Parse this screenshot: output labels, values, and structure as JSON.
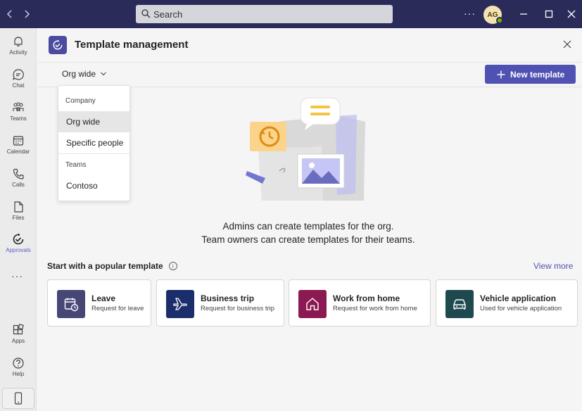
{
  "titlebar": {
    "search_placeholder": "Search",
    "avatar_initials": "AG",
    "more_label": "···"
  },
  "rail": {
    "items": [
      {
        "label": "Activity",
        "icon": "bell-icon"
      },
      {
        "label": "Chat",
        "icon": "chat-icon"
      },
      {
        "label": "Teams",
        "icon": "teams-icon"
      },
      {
        "label": "Calendar",
        "icon": "calendar-icon"
      },
      {
        "label": "Calls",
        "icon": "phone-icon"
      },
      {
        "label": "Files",
        "icon": "file-icon"
      },
      {
        "label": "Approvals",
        "icon": "approvals-icon",
        "active": true
      },
      {
        "label": "Apps",
        "icon": "apps-icon"
      },
      {
        "label": "Help",
        "icon": "help-icon"
      }
    ],
    "more_label": "···"
  },
  "header": {
    "title": "Template management"
  },
  "toolbar": {
    "scope_selected": "Org wide",
    "new_template_label": "New template"
  },
  "dropdown": {
    "group_company": "Company",
    "item_org_wide": "Org wide",
    "item_specific_people": "Specific people",
    "group_teams": "Teams",
    "item_contoso": "Contoso",
    "selected": "Org wide"
  },
  "empty_state": {
    "line1": "Admins can create templates for the org.",
    "line2": "Team owners can create templates for their teams."
  },
  "popular": {
    "title": "Start with a popular template",
    "view_more": "View more",
    "cards": [
      {
        "title": "Leave",
        "subtitle": "Request for leave",
        "color": "#464775",
        "icon": "calendar-clock-icon"
      },
      {
        "title": "Business trip",
        "subtitle": "Request for business trip",
        "color": "#1b2d6b",
        "icon": "airplane-icon"
      },
      {
        "title": "Work from home",
        "subtitle": "Request for work from home",
        "color": "#8b1a52",
        "icon": "home-icon"
      },
      {
        "title": "Vehicle application",
        "subtitle": "Used for vehicle application",
        "color": "#1e4a4f",
        "icon": "car-icon"
      }
    ]
  },
  "colors": {
    "titlebar": "#2b2b5a",
    "accent": "#4f52b2",
    "presence": "#6bb700"
  }
}
